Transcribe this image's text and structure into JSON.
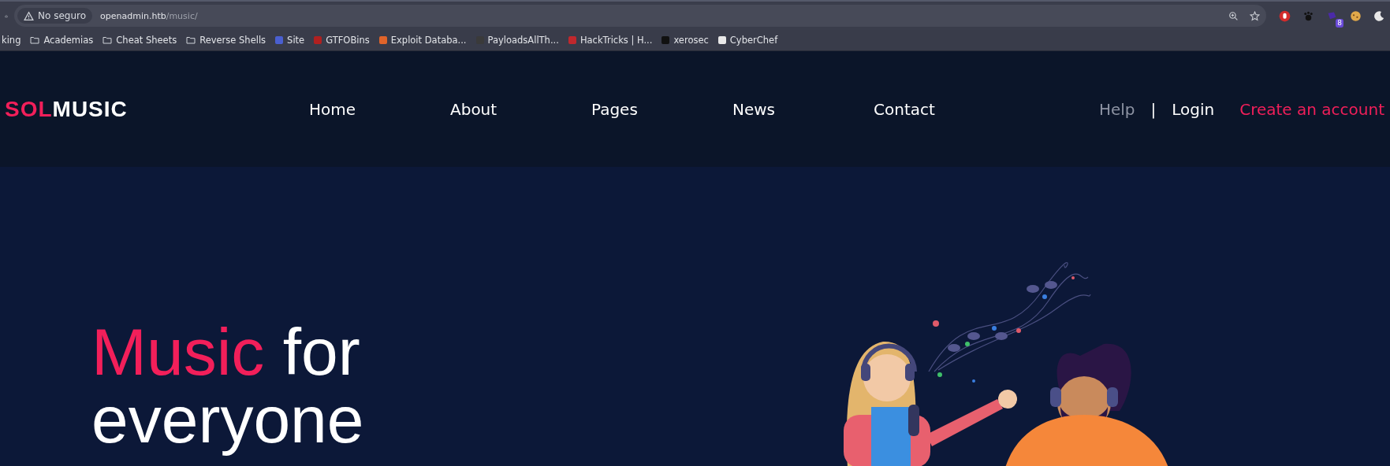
{
  "browser": {
    "security_label": "No seguro",
    "address_host": "openadmin.htb",
    "address_path": "/music/",
    "extension_badge": "8",
    "bookmarks": [
      {
        "label": "king",
        "kind": "cut"
      },
      {
        "label": "Academias",
        "kind": "folder"
      },
      {
        "label": "Cheat Sheets",
        "kind": "folder"
      },
      {
        "label": "Reverse Shells",
        "kind": "folder"
      },
      {
        "label": "Site",
        "kind": "site",
        "color": "#4a5fd0"
      },
      {
        "label": "GTFOBins",
        "kind": "site",
        "color": "#b02020"
      },
      {
        "label": "Exploit Databa...",
        "kind": "site",
        "color": "#e0642a"
      },
      {
        "label": "PayloadsAllTh...",
        "kind": "site",
        "color": "#3a3a3a"
      },
      {
        "label": "HackTricks | H...",
        "kind": "site",
        "color": "#c0282d"
      },
      {
        "label": "xerosec",
        "kind": "site",
        "color": "#111111"
      },
      {
        "label": "CyberChef",
        "kind": "site",
        "color": "#e8e8e8"
      }
    ]
  },
  "site": {
    "logo": {
      "accent": "SOL",
      "rest": "MUSIC"
    },
    "nav": [
      {
        "label": "Home"
      },
      {
        "label": "About"
      },
      {
        "label": "Pages"
      },
      {
        "label": "News"
      },
      {
        "label": "Contact"
      }
    ],
    "account_links": [
      {
        "label": "Help",
        "kind": "muted"
      },
      {
        "label": "|",
        "kind": "separator"
      },
      {
        "label": "Login",
        "kind": "plain"
      },
      {
        "label": "Create an account",
        "kind": "accent"
      }
    ],
    "hero": {
      "title_accent": "Music",
      "title_rest": "for",
      "title_line2": "everyone"
    }
  }
}
